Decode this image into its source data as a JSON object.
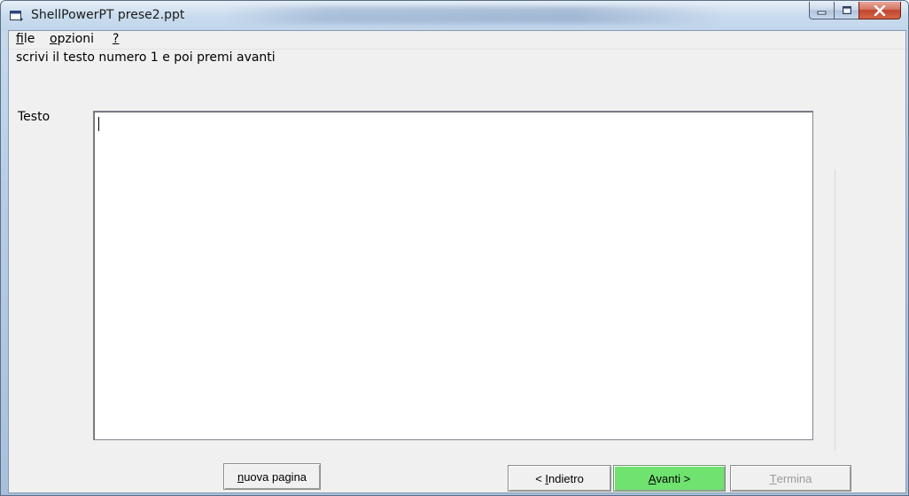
{
  "window": {
    "title": "ShellPowerPT prese2.ppt",
    "controls": {
      "minimize": "minimize",
      "maximize": "maximize",
      "close": "close"
    }
  },
  "menu": {
    "file": {
      "mnemonic": "f",
      "rest": "ile"
    },
    "opzioni": {
      "mnemonic": "o",
      "rest": "pzioni"
    },
    "help": {
      "mnemonic": "?",
      "rest": ""
    }
  },
  "instruction": "scrivi il testo numero 1 e poi premi avanti",
  "form": {
    "testo_label": "Testo",
    "testo_value": ""
  },
  "buttons": {
    "nuova_pagina": {
      "mnemonic": "n",
      "rest": "uova pagina"
    },
    "indietro": {
      "prefix": "< ",
      "mnemonic": "I",
      "rest": "ndietro"
    },
    "avanti": {
      "mnemonic": "A",
      "rest": "vanti >"
    },
    "termina": {
      "mnemonic": "T",
      "rest": "ermina",
      "enabled": false
    }
  },
  "colors": {
    "avanti_button": "#6fe26f",
    "close_button": "#c2452c",
    "disabled_text": "#9a9a9a"
  }
}
